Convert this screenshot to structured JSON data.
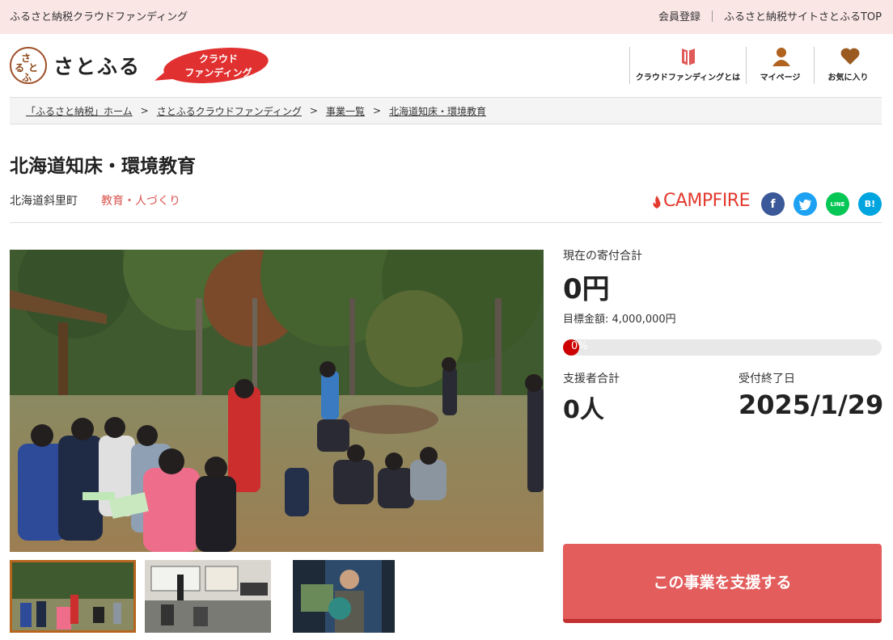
{
  "topbar": {
    "tagline": "ふるさと納税クラウドファンディング",
    "register": "会員登録",
    "satofull_top": "ふるさと納税サイトさとふるTOP"
  },
  "header": {
    "logo_text": "さとふる",
    "logo_mark_chars": [
      "さ",
      "と",
      "ふ",
      "る"
    ],
    "badge_line1": "クラウド",
    "badge_line2": "ファンディング",
    "nav": [
      {
        "label": "クラウドファンディングとは",
        "icon": "book-icon"
      },
      {
        "label": "マイページ",
        "icon": "person-icon"
      },
      {
        "label": "お気に入り",
        "icon": "heart-icon"
      }
    ]
  },
  "breadcrumb": [
    "「ふるさと納税」ホーム",
    "さとふるクラウドファンディング",
    "事業一覧",
    "北海道知床・環境教育"
  ],
  "project": {
    "title": "北海道知床・環境教育",
    "location": "北海道斜里町",
    "category": "教育・人づくり",
    "partner": "CAMPFIRE"
  },
  "share": {
    "facebook": "f",
    "line": "LINE",
    "hatena": "B!"
  },
  "stats": {
    "total_label": "現在の寄付合計",
    "total_value": "0円",
    "goal_text": "目標金額: 4,000,000円",
    "progress_text": "0%",
    "progress_fraction": 0.0,
    "supporters_label": "支援者合計",
    "supporters_value": "0人",
    "deadline_label": "受付終了日",
    "deadline_value": "2025/1/29"
  },
  "cta": {
    "support_label": "この事業を支援する"
  },
  "colors": {
    "accent": "#e35d5d",
    "topbar_bg": "#fbe6e6",
    "progress_fill": "#cc0000",
    "category": "#d9534f"
  }
}
